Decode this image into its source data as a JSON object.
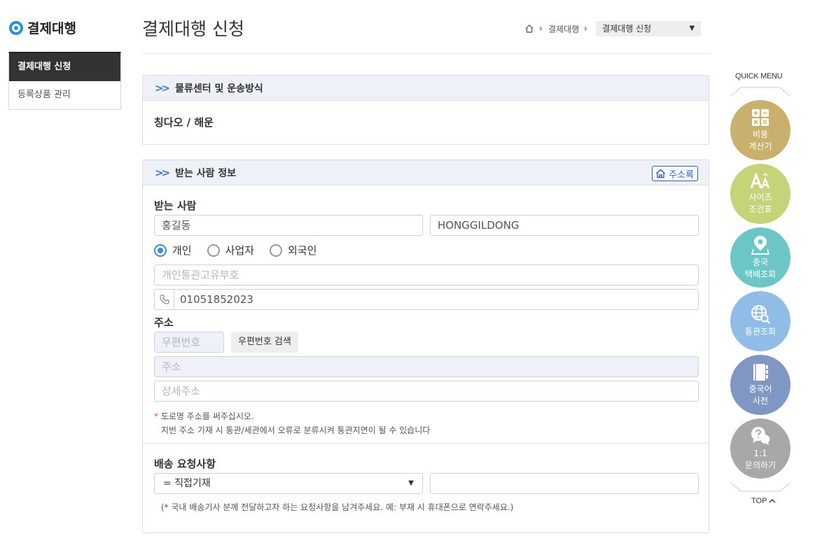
{
  "sidebar": {
    "title": "결제대행",
    "items": [
      {
        "label": "결제대행 신청",
        "active": true
      },
      {
        "label": "등록상품 관리",
        "active": false
      }
    ]
  },
  "header": {
    "title": "결제대행 신청",
    "breadcrumb": {
      "level1": "결제대행",
      "current": "결제대행 신청"
    }
  },
  "logistics": {
    "title": "물류센터 및 운송방식",
    "value": "칭다오 / 해운"
  },
  "recipient": {
    "title": "받는 사람 정보",
    "address_book_label": "주소록",
    "name_label": "받는 사람",
    "name_kr": "홍길동",
    "name_en": "HONGGILDONG",
    "radios": [
      {
        "label": "개인",
        "checked": true
      },
      {
        "label": "사업자",
        "checked": false
      },
      {
        "label": "외국인",
        "checked": false
      }
    ],
    "customs_placeholder": "개인통관고유부호",
    "phone": "01051852023",
    "address_label": "주소",
    "zip_placeholder": "우편번호",
    "zip_search_label": "우편번호 검색",
    "address_placeholder": "주소",
    "detail_placeholder": "상세주소",
    "note_star": "*",
    "note_line1": "도로명 주소를 써주십시오.",
    "note_line2": "지번 주소 기재 시 통관/세관에서 오류로 분류시켜 통관지연이 될 수 있습니다",
    "delivery_label": "배송 요청사항",
    "delivery_select": "= 직접기재",
    "delivery_input": "",
    "delivery_note": "(* 국내 배송기사 분께 전달하고자 하는 요청사항을 남겨주세요. 예: 부재 시 휴대폰으로 연락주세요.)"
  },
  "quick_menu": {
    "title": "QUICK MENU",
    "top_label": "TOP",
    "buttons": [
      {
        "line1": "비용",
        "line2": "계산기",
        "color": "#c9b06c",
        "icon": "calculator-icon"
      },
      {
        "line1": "사이즈",
        "line2": "조건표",
        "color": "#c6d379",
        "icon": "font-size-icon"
      },
      {
        "line1": "중국",
        "line2": "택배조회",
        "color": "#6cc6c6",
        "icon": "map-pin-icon"
      },
      {
        "line1": "통관조회",
        "line2": "",
        "color": "#8fbde8",
        "icon": "globe-search-icon"
      },
      {
        "line1": "중국어",
        "line2": "사전",
        "color": "#7f97c2",
        "icon": "book-icon"
      },
      {
        "line1": "1:1",
        "line2": "문의하기",
        "color": "#a8a8a8",
        "icon": "question-chat-icon"
      }
    ]
  }
}
